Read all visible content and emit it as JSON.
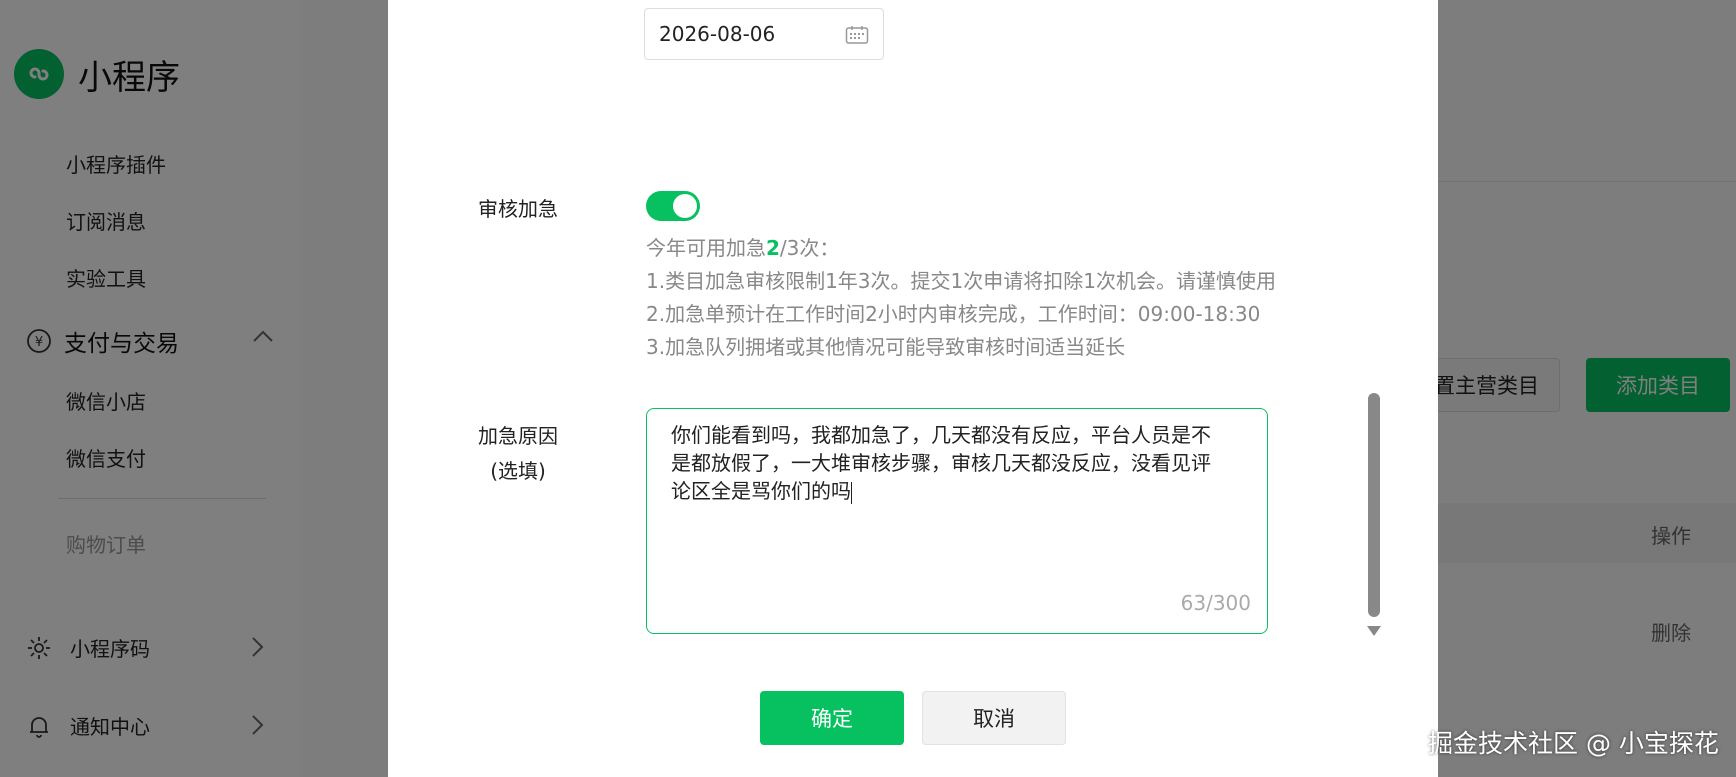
{
  "sidebar": {
    "logo_text": "小程序",
    "items": [
      {
        "label": "小程序插件"
      },
      {
        "label": "订阅消息"
      },
      {
        "label": "实验工具"
      }
    ],
    "group_pay": {
      "label": "支付与交易",
      "icon": "yen-icon"
    },
    "pay_items": [
      {
        "label": "微信小店"
      },
      {
        "label": "微信支付"
      }
    ],
    "dim_item": "购物订单",
    "link_qrcode": {
      "label": "小程序码",
      "icon": "qrcode-icon"
    },
    "link_notify": {
      "label": "通知中心",
      "icon": "bell-icon"
    }
  },
  "content": {
    "btn_set_main": "置主营类目",
    "btn_add": "添加类目",
    "th_operation": "操作",
    "td_delete": "删除"
  },
  "modal": {
    "date_value": "2026-08-06",
    "urgent_label": "审核加急",
    "toggle_on": true,
    "hint_prefix": "今年可用加急",
    "hint_count": "2",
    "hint_suffix": "/3次：",
    "hint_1": "1.类目加急审核限制1年3次。提交1次申请将扣除1次机会。请谨慎使用",
    "hint_2": "2.加急单预计在工作时间2小时内审核完成，工作时间：09:00-18:30",
    "hint_3": "3.加急队列拥堵或其他情况可能导致审核时间适当延长",
    "reason_label_1": "加急原因",
    "reason_label_2": "(选填)",
    "reason_text_1": "你们能看到吗，我都加急了，几天都没有反应，平台人员是不",
    "reason_text_2": "是都放假了，一大堆审核步骤，审核几天都没反应，没看见评",
    "reason_text_3": "论区全是骂你们的吗",
    "counter": "63/300",
    "ok_label": "确定",
    "cancel_label": "取消"
  },
  "watermark": "掘金技术社区 @ 小宝探花",
  "colors": {
    "accent": "#07c160"
  }
}
